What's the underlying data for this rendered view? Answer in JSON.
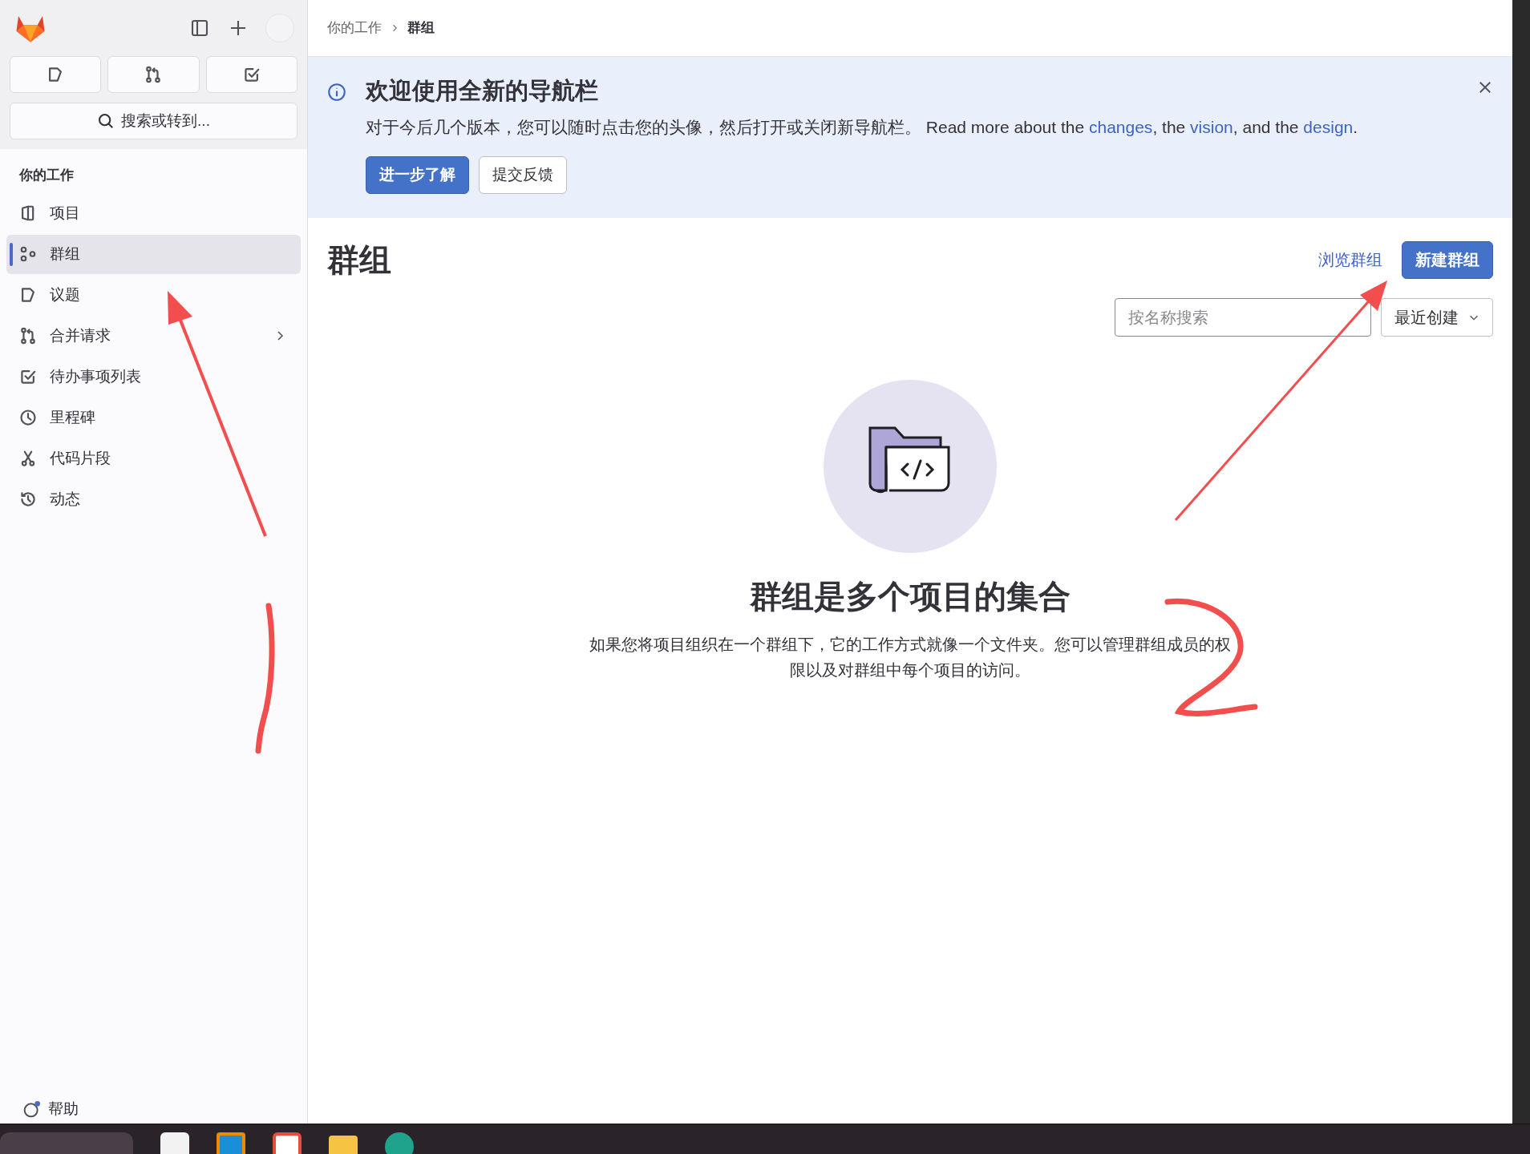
{
  "breadcrumb": [
    {
      "label": "你的工作",
      "current": false
    },
    {
      "label": "群组",
      "current": true
    }
  ],
  "sidebar": {
    "search": {
      "label": "搜索或转到..."
    },
    "section_title": "你的工作",
    "items": [
      {
        "label": "项目",
        "selected": false,
        "submenu": false
      },
      {
        "label": "群组",
        "selected": true,
        "submenu": false
      },
      {
        "label": "议题",
        "selected": false,
        "submenu": false
      },
      {
        "label": "合并请求",
        "selected": false,
        "submenu": true
      },
      {
        "label": "待办事项列表",
        "selected": false,
        "submenu": false
      },
      {
        "label": "里程碑",
        "selected": false,
        "submenu": false
      },
      {
        "label": "代码片段",
        "selected": false,
        "submenu": false
      },
      {
        "label": "动态",
        "selected": false,
        "submenu": false
      }
    ],
    "help": "帮助"
  },
  "banner": {
    "title": "欢迎使用全新的导航栏",
    "parts": [
      {
        "kind": "text",
        "text": "对于今后几个版本，您可以随时点击您的头像，然后打开或关闭新导航栏。 Read more about the "
      },
      {
        "kind": "link",
        "text": "changes"
      },
      {
        "kind": "text",
        "text": ", the "
      },
      {
        "kind": "link",
        "text": "vision"
      },
      {
        "kind": "text",
        "text": ", and the "
      },
      {
        "kind": "link",
        "text": "design"
      },
      {
        "kind": "text",
        "text": "."
      }
    ],
    "buttons": [
      {
        "label": "进一步了解",
        "kind": "primary"
      },
      {
        "label": "提交反馈",
        "kind": "secondary"
      }
    ]
  },
  "page": {
    "title": "群组",
    "browse_link": "浏览群组",
    "new_button": "新建群组",
    "search": {
      "placeholder": "按名称搜索"
    },
    "sort": "最近创建"
  },
  "empty_state": {
    "title": "群组是多个项目的集合",
    "description": "如果您将项目组织在一个群组下，它的工作方式就像一个文件夹。您可以管理群组成员的权限以及对群组中每个项目的访问。"
  }
}
